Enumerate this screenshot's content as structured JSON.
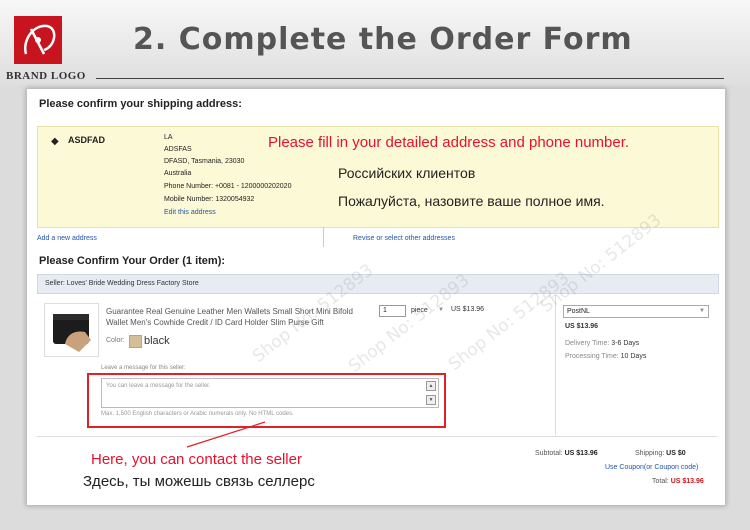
{
  "header": {
    "brand_logo": "BRAND LOGO",
    "title": "2. Complete the Order Form",
    "logo_icon": "brand-logo-icon",
    "brand_color": "#c8141e"
  },
  "shipping": {
    "heading": "Please confirm your shipping address:",
    "name": "ASDFAD",
    "address_lines": [
      "LA",
      "ADSFAS",
      "DFASD, Tasmania, 23030",
      "Australia",
      "Phone Number:  +0081 - 1200000202020",
      "Mobile Number:  1320054932"
    ],
    "edit_link": "Edit this address",
    "add_address_link": "Add a new address",
    "revise_link": "Revise or select other addresses"
  },
  "annotations": {
    "fill_address": "Please fill in your detailed address and phone number.",
    "fill_address_ru": "Российских клиентов",
    "full_name_ru": "Пожалуйста, назовите ваше полное имя.",
    "contact_seller": "Here, you can contact the seller",
    "contact_seller_ru": "Здесь, ты можешь связь селлерс",
    "accent_red": "#e8112d"
  },
  "order": {
    "heading": "Please Confirm Your Order (1 item):",
    "seller": "Seller: Loves' Bride Wedding Dress Factory Store",
    "product_title": "Guarantee Real Genuine Leather Men Wallets Small Short Mini Bifold Wallet Men's Cowhide Credit / ID Card Holder Slim Purse Gift",
    "color_label": "Color:",
    "color_value": "black",
    "quantity": "1",
    "unit": "piece",
    "price": "US $13.96",
    "shipping_method": "PostNL",
    "shipping_cost": "US $13.96",
    "delivery_label": "Delivery Time:",
    "delivery_value": "3-6 Days",
    "processing_label": "Processing Time:",
    "processing_value": "10 Days",
    "message_label": "Leave a message for this seller:",
    "message_placeholder": "You can leave a message for the seller.",
    "message_hint": "Max. 1,500 English characters or Arabic numerals only. No HTML codes."
  },
  "summary": {
    "subtotal_label": "Subtotal:",
    "subtotal_value": "US $13.96",
    "shipping_label": "Shipping:",
    "shipping_value": "US $0",
    "coupon_link": "Use Coupon(or Coupon code)",
    "total_label": "Total:",
    "total_value": "US $13.96"
  },
  "watermark": "Shop No: 512893"
}
